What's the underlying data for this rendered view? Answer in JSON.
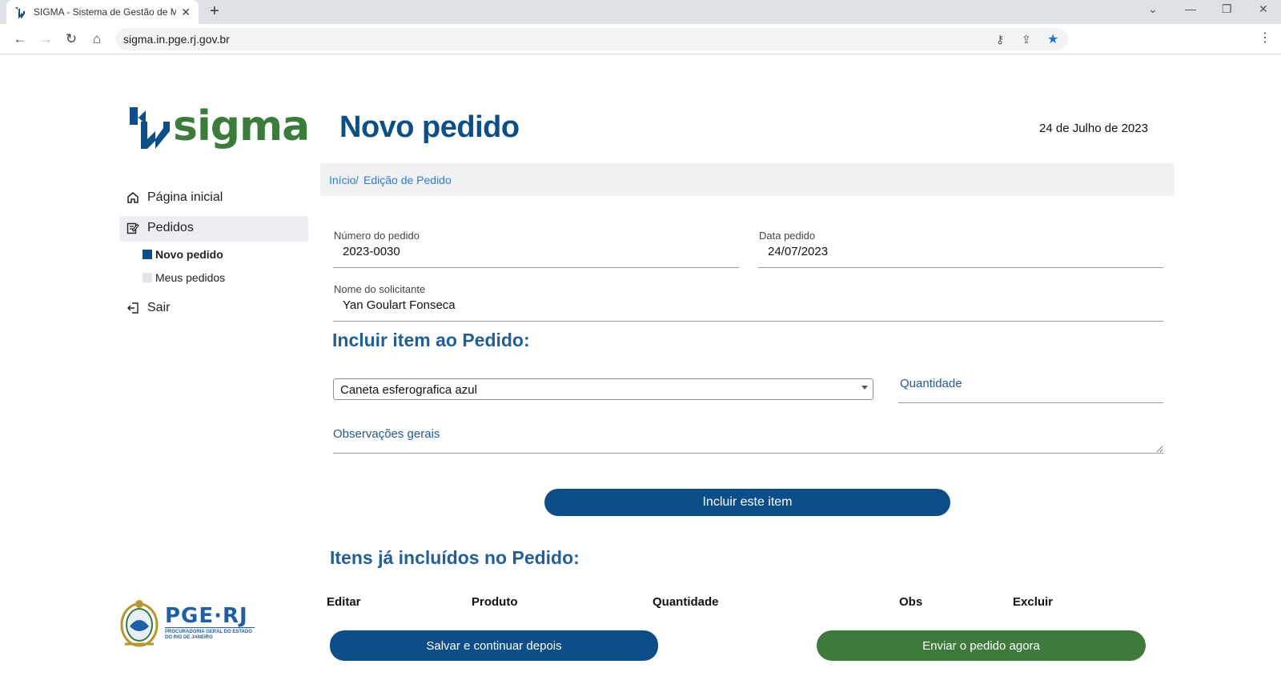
{
  "browser": {
    "tab_title": "SIGMA - Sistema de Gestão de M",
    "url": "sigma.in.pge.rj.gov.br",
    "new_tab_symbol": "+",
    "close_symbol": "✕"
  },
  "header": {
    "logo_text": "sigma",
    "page_title": "Novo pedido",
    "date": "24 de Julho de 2023"
  },
  "breadcrumb": {
    "home": "Início",
    "separator": " / ",
    "current": "Edição de Pedido"
  },
  "sidebar": {
    "items": [
      {
        "label": "Página inicial",
        "icon": "home-icon"
      },
      {
        "label": "Pedidos",
        "icon": "edit-icon"
      },
      {
        "label": "Sair",
        "icon": "logout-icon"
      }
    ],
    "subitems": [
      {
        "label": "Novo pedido",
        "active": true
      },
      {
        "label": "Meus pedidos",
        "active": false
      }
    ]
  },
  "footer_logo": {
    "title": "PGE·RJ",
    "subtitle": "PROCURADORIA GERAL DO ESTADO DO RIO DE JANEIRO"
  },
  "form": {
    "numero_label": "Número do pedido",
    "numero_value": "2023-0030",
    "data_label": "Data pedido",
    "data_value": "24/07/2023",
    "solicitante_label": "Nome do solicitante",
    "solicitante_value": "Yan Goulart Fonseca",
    "include_heading": "Incluir item ao Pedido:",
    "product_selected": "Caneta esferografica azul",
    "quantity_placeholder": "Quantidade",
    "obs_placeholder": "Observações gerais",
    "include_button": "Incluir este item"
  },
  "items_section": {
    "heading": "Itens já incluídos no Pedido:",
    "columns": [
      "Editar",
      "Produto",
      "Quantidade",
      "Obs",
      "Excluir"
    ]
  },
  "actions": {
    "save_later": "Salvar e continuar depois",
    "send_now": "Enviar o pedido agora"
  },
  "colors": {
    "primary_blue": "#0c4d8a",
    "brand_green": "#3e7a3b",
    "link_blue": "#2f7bd0"
  }
}
